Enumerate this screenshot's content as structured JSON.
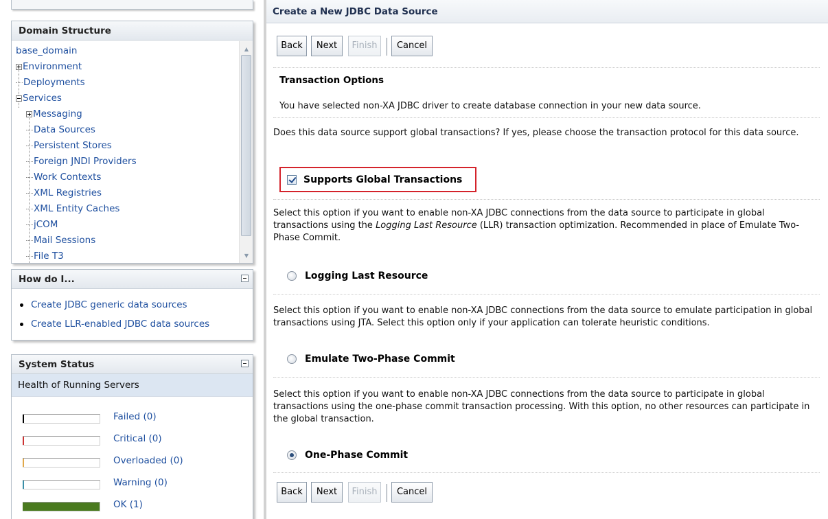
{
  "domain_structure": {
    "title": "Domain Structure",
    "items": [
      {
        "label": "base_domain",
        "type": "root"
      },
      {
        "label": "Environment",
        "type": "expandable",
        "expanded": false
      },
      {
        "label": "Deployments",
        "type": "leaf"
      },
      {
        "label": "Services",
        "type": "expandable",
        "expanded": true
      },
      {
        "label": "Messaging",
        "type": "expandable",
        "expanded": false
      },
      {
        "label": "Data Sources",
        "type": "leaf"
      },
      {
        "label": "Persistent Stores",
        "type": "leaf"
      },
      {
        "label": "Foreign JNDI Providers",
        "type": "leaf"
      },
      {
        "label": "Work Contexts",
        "type": "leaf"
      },
      {
        "label": "XML Registries",
        "type": "leaf"
      },
      {
        "label": "XML Entity Caches",
        "type": "leaf"
      },
      {
        "label": "jCOM",
        "type": "leaf"
      },
      {
        "label": "Mail Sessions",
        "type": "leaf"
      },
      {
        "label": "File T3",
        "type": "leaf"
      }
    ]
  },
  "how_do_i": {
    "title": "How do I...",
    "links": [
      "Create JDBC generic data sources",
      "Create LLR-enabled JDBC data sources"
    ]
  },
  "system_status": {
    "title": "System Status",
    "subtitle": "Health of Running Servers",
    "rows": [
      {
        "label": "Failed (0)",
        "color": "#000000",
        "fill": 0
      },
      {
        "label": "Critical (0)",
        "color": "#cc3333",
        "fill": 0
      },
      {
        "label": "Overloaded (0)",
        "color": "#e0a84a",
        "fill": 0
      },
      {
        "label": "Warning (0)",
        "color": "#3a8fa8",
        "fill": 0
      },
      {
        "label": "OK (1)",
        "color": "#4a7a1f",
        "fill": 1
      }
    ]
  },
  "main": {
    "title": "Create a New JDBC Data Source",
    "buttons": {
      "back": "Back",
      "next": "Next",
      "finish": "Finish",
      "cancel": "Cancel"
    },
    "section_title": "Transaction Options",
    "intro": "You have selected non-XA JDBC driver to create database connection in your new data source.",
    "question": "Does this data source support global transactions? If yes, please choose the transaction protocol for this data source.",
    "supports_global": {
      "label": "Supports Global Transactions",
      "checked": true
    },
    "llr_desc_pre": "Select this option if you want to enable non-XA JDBC connections from the data source to participate in global transactions using the ",
    "llr_desc_em": "Logging Last Resource",
    "llr_desc_post": " (LLR) transaction optimization. Recommended in place of Emulate Two-Phase Commit.",
    "llr_label": "Logging Last Resource",
    "emulate_desc": "Select this option if you want to enable non-XA JDBC connections from the data source to emulate participation in global transactions using JTA. Select this option only if your application can tolerate heuristic conditions.",
    "emulate_label": "Emulate Two-Phase Commit",
    "onephase_desc": "Select this option if you want to enable non-XA JDBC connections from the data source to participate in global transactions using the one-phase commit transaction processing. With this option, no other resources can participate in the global transaction.",
    "onephase_label": "One-Phase Commit",
    "selected_protocol": "One-Phase Commit"
  }
}
